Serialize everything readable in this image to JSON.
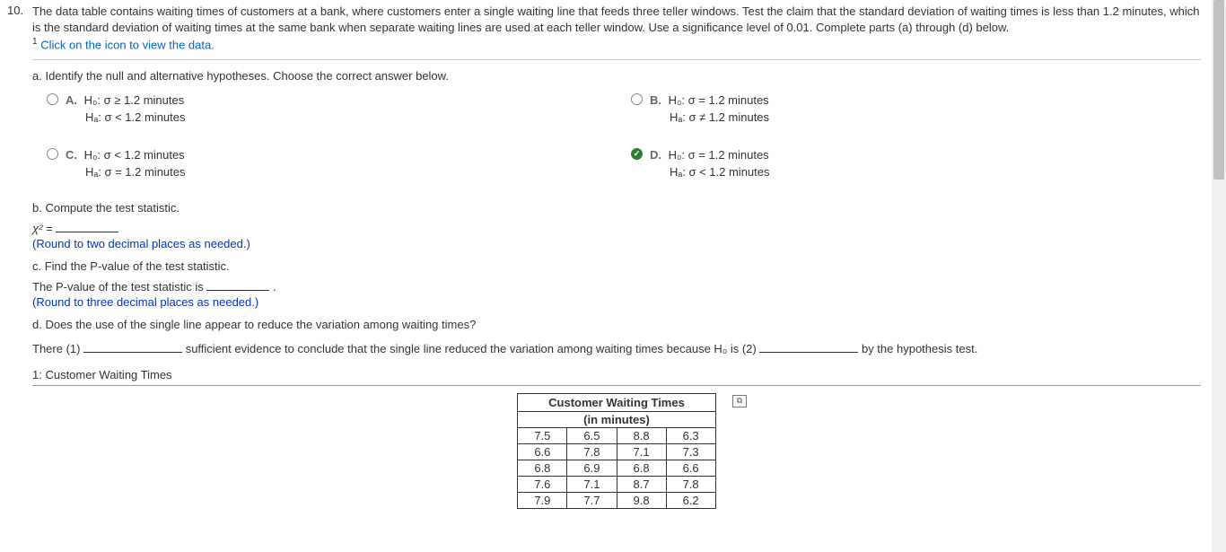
{
  "question_number": "10.",
  "intro_text": "The data table contains waiting times of customers at a bank, where customers enter a single waiting line that feeds three teller windows. Test the claim that the standard deviation of waiting times is less than 1.2 minutes, which is the standard deviation of waiting times at the same bank when separate waiting lines are used at each teller window. Use a significance level of 0.01. Complete parts (a) through (d) below.",
  "icon_sup": "1",
  "icon_text": " Click on the icon to view the data.",
  "part_a_label": "a. Identify the null and alternative hypotheses. Choose the correct answer below.",
  "options": {
    "A": {
      "letter": "A.",
      "l1": "H₀: σ ≥ 1.2 minutes",
      "l2": "Hₐ: σ < 1.2 minutes"
    },
    "B": {
      "letter": "B.",
      "l1": "H₀: σ = 1.2 minutes",
      "l2": "Hₐ: σ ≠ 1.2 minutes"
    },
    "C": {
      "letter": "C.",
      "l1": "H₀: σ < 1.2 minutes",
      "l2": "Hₐ: σ = 1.2 minutes"
    },
    "D": {
      "letter": "D.",
      "l1": "H₀: σ = 1.2 minutes",
      "l2": "Hₐ: σ < 1.2 minutes"
    }
  },
  "part_b_label": "b. Compute the test statistic.",
  "chi_text": "χ² = ",
  "round2": "(Round to two decimal places as needed.)",
  "part_c_label": "c. Find the P-value of the test statistic.",
  "pvalue_text_pre": "The P-value of the test statistic is ",
  "pvalue_text_post": ".",
  "round3": "(Round to three decimal places as needed.)",
  "part_d_label": "d. Does the use of the single line appear to reduce the variation among waiting times?",
  "conclusion_pre": "There  (1) ",
  "conclusion_mid1": " sufficient evidence to conclude that the single line reduced the variation among waiting times because H₀ is  (2) ",
  "conclusion_post": " by the hypothesis test.",
  "data_title": "1: Customer Waiting Times",
  "table_header": "Customer Waiting Times",
  "table_sub": "(in minutes)",
  "table_rows": [
    [
      "7.5",
      "6.5",
      "8.8",
      "6.3"
    ],
    [
      "6.6",
      "7.8",
      "7.1",
      "7.3"
    ],
    [
      "6.8",
      "6.9",
      "6.8",
      "6.6"
    ],
    [
      "7.6",
      "7.1",
      "8.7",
      "7.8"
    ],
    [
      "7.9",
      "7.7",
      "9.8",
      "6.2"
    ]
  ]
}
